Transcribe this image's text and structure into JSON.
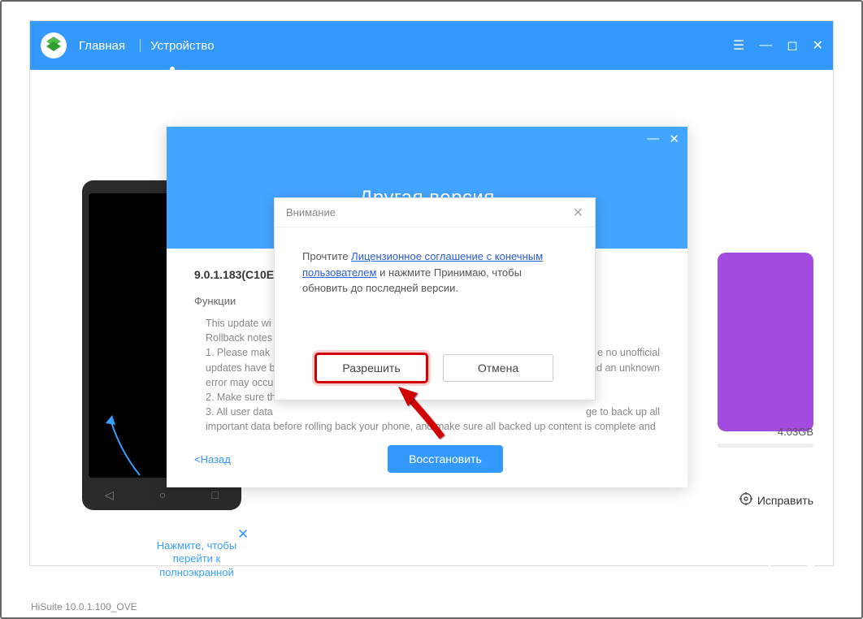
{
  "app": {
    "nav_home": "Главная",
    "nav_device": "Устройство",
    "status": "HiSuite 10.0.1.100_OVE"
  },
  "side": {
    "size": "4.03GB",
    "fix": "Исправить"
  },
  "phone": {
    "hint": "Нажмите, чтобы перейти к полноэкранной"
  },
  "dlg1": {
    "title": "Другая версия",
    "version": "9.0.1.183(C10E",
    "functions_label": "Функции",
    "notes_l1": "This update wi",
    "notes_l2": "Rollback notes",
    "notes_l3": "1. Please mak",
    "notes_l3b": "e no unofficial",
    "notes_l4": "updates have b",
    "notes_l4b": "nd an unknown",
    "notes_l5": "error may occu",
    "notes_l6": "2. Make sure th",
    "notes_l7": "3. All user data",
    "notes_l7b": "ge to back up all",
    "notes_l8": "important data before rolling back your phone, and make sure all backed up content is complete and",
    "back": "<Назад",
    "restore": "Восстановить"
  },
  "dlg2": {
    "header": "Внимание",
    "text_pre": "Прочтите ",
    "link": "Лицензионное соглашение с конечным пользователем",
    "text_post": " и нажмите Принимаю, чтобы обновить до последней версии.",
    "allow": "Разрешить",
    "cancel": "Отмена"
  }
}
